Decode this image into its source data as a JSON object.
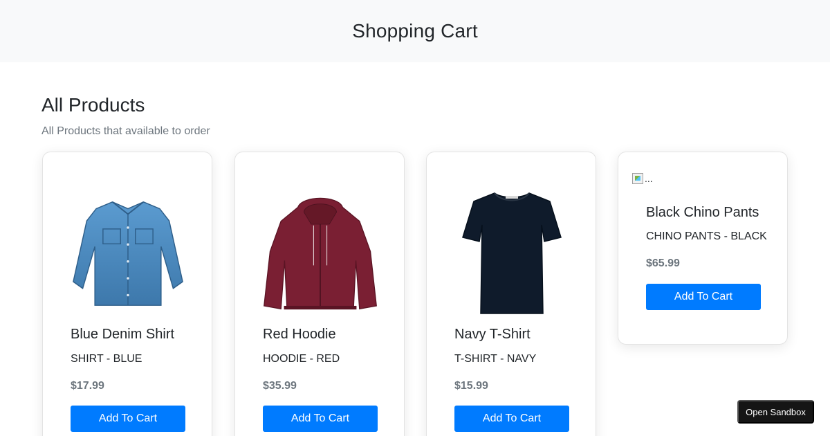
{
  "header": {
    "title": "Shopping Cart"
  },
  "section": {
    "title": "All Products",
    "subtitle": "All Products that available to order"
  },
  "products": [
    {
      "name": "Blue Denim Shirt",
      "subtitle": "SHIRT - BLUE",
      "price": "$17.99",
      "button_label": "Add To Cart",
      "image": "blue-denim-shirt",
      "color": "#4a86b8"
    },
    {
      "name": "Red Hoodie",
      "subtitle": "HOODIE - RED",
      "price": "$35.99",
      "button_label": "Add To Cart",
      "image": "red-hoodie",
      "color": "#7a1f33"
    },
    {
      "name": "Navy T-Shirt",
      "subtitle": "T-SHIRT - NAVY",
      "price": "$15.99",
      "button_label": "Add To Cart",
      "image": "navy-tshirt",
      "color": "#0f1b2b"
    },
    {
      "name": "Black Chino Pants",
      "subtitle": "CHINO PANTS - BLACK",
      "price": "$65.99",
      "button_label": "Add To Cart",
      "image_alt": "...",
      "image_broken": true
    }
  ],
  "sandbox_button": {
    "label": "Open Sandbox"
  },
  "colors": {
    "primary": "#007bff",
    "header_bg": "#f8f9fa",
    "muted": "#6c757d"
  }
}
